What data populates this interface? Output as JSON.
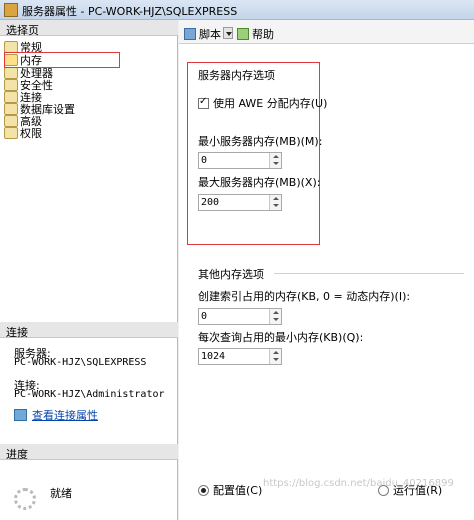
{
  "window": {
    "title": "服务器属性 - PC-WORK-HJZ\\SQLEXPRESS"
  },
  "left": {
    "select_page_heading": "选择页",
    "pages": [
      {
        "label": "常规",
        "icon": "page-icon"
      },
      {
        "label": "内存",
        "icon": "page-icon",
        "selected": true
      },
      {
        "label": "处理器",
        "icon": "page-icon"
      },
      {
        "label": "安全性",
        "icon": "page-icon"
      },
      {
        "label": "连接",
        "icon": "page-icon"
      },
      {
        "label": "数据库设置",
        "icon": "page-icon"
      },
      {
        "label": "高级",
        "icon": "page-icon"
      },
      {
        "label": "权限",
        "icon": "page-icon"
      }
    ],
    "connection_heading": "连接",
    "server_label": "服务器:",
    "server_value": "PC-WORK-HJZ\\SQLEXPRESS",
    "connection_label": "连接:",
    "connection_value": "PC-WORK-HJZ\\Administrator",
    "view_connection_link": "查看连接属性",
    "progress_heading": "进度",
    "progress_status": "就绪"
  },
  "toolbar": {
    "script_label": "脚本",
    "help_label": "帮助"
  },
  "server_memory": {
    "group_title": "服务器内存选项",
    "awe_checkbox_label": "使用 AWE 分配内存(U)",
    "awe_checked": true,
    "min_label": "最小服务器内存(MB)(M):",
    "min_value": "0",
    "max_label": "最大服务器内存(MB)(X):",
    "max_value": "200"
  },
  "other_memory": {
    "group_title": "其他内存选项",
    "index_label": "创建索引占用的内存(KB, 0 = 动态内存)(I):",
    "index_value": "0",
    "query_label": "每次查询占用的最小内存(KB)(Q):",
    "query_value": "1024"
  },
  "bottom": {
    "config_value_label": "配置值(C)",
    "running_value_label": "运行值(R)",
    "selected": "config",
    "watermark": "https://blog.csdn.net/baidu_40216899"
  },
  "colors": {
    "highlight_border": "#e0383f",
    "link": "#0645ad"
  }
}
